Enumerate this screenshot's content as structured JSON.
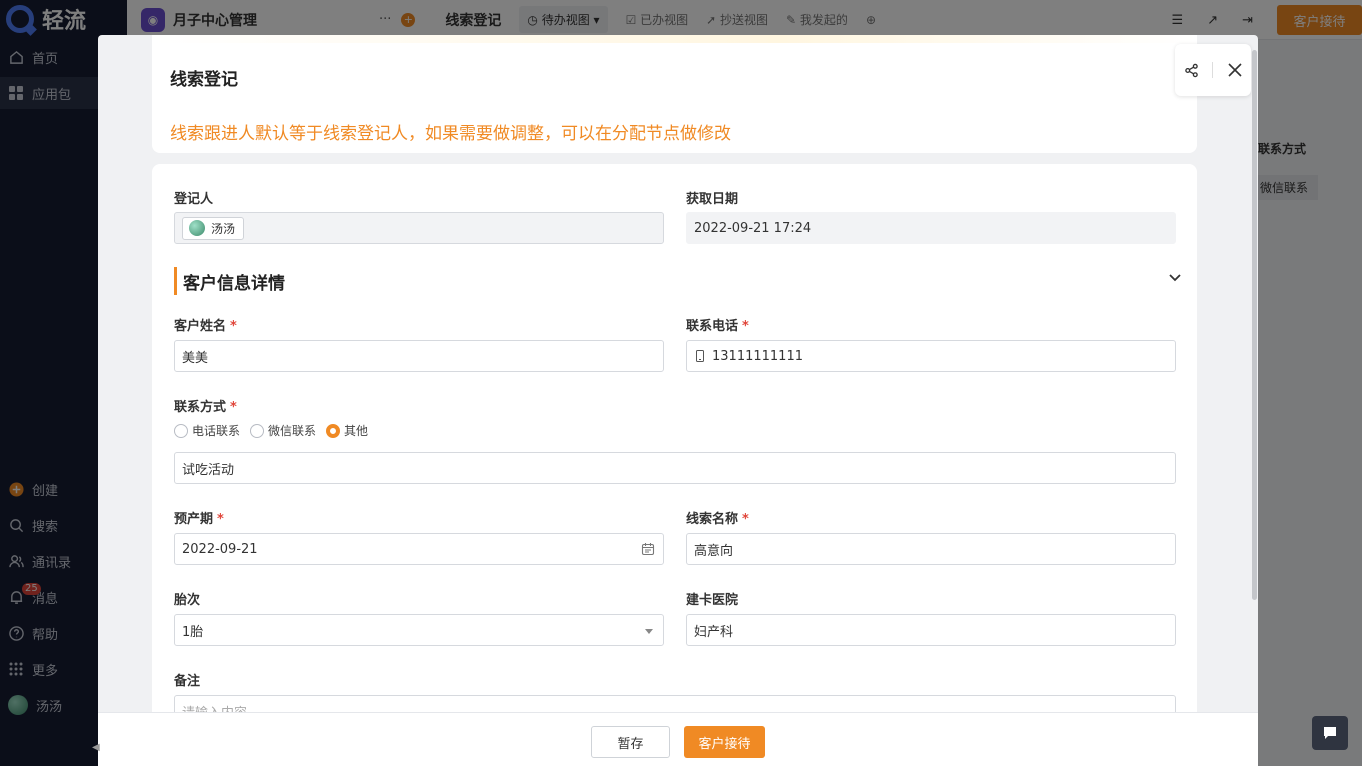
{
  "app": {
    "logo_text": "轻流",
    "title": "月子中心管理",
    "more": "···"
  },
  "sidebar": {
    "items": [
      {
        "label": "首页",
        "icon": "home-icon"
      },
      {
        "label": "应用包",
        "icon": "grid-icon",
        "active": true
      }
    ],
    "bottom_items": [
      {
        "label": "创建",
        "icon": "plus-circle-icon"
      },
      {
        "label": "搜索",
        "icon": "search-icon"
      },
      {
        "label": "通讯录",
        "icon": "contacts-icon"
      },
      {
        "label": "消息",
        "icon": "bell-icon",
        "badge": "25"
      },
      {
        "label": "帮助",
        "icon": "help-icon"
      },
      {
        "label": "更多",
        "icon": "more-grid-icon"
      },
      {
        "label": "汤汤",
        "icon": "avatar"
      }
    ]
  },
  "topbar": {
    "form_name": "线索登记",
    "views": [
      {
        "label": "待办视图",
        "active": true
      },
      {
        "label": "已办视图"
      },
      {
        "label": "抄送视图"
      },
      {
        "label": "我发起的"
      }
    ],
    "primary_button": "客户接待"
  },
  "background_table": {
    "header": "联系方式",
    "cell": "微信联系"
  },
  "modal": {
    "title": "线索登记",
    "description": "线索跟进人默认等于线索登记人，如果需要做调整，可以在分配节点做修改",
    "registrant": {
      "label": "登记人",
      "value": "汤汤"
    },
    "acquire_date": {
      "label": "获取日期",
      "value": "2022-09-21 17:24"
    },
    "section_title": "客户信息详情",
    "customer_name": {
      "label": "客户姓名",
      "required": "*",
      "value": "美美"
    },
    "phone": {
      "label": "联系电话",
      "required": "*",
      "value": "13111111111"
    },
    "contact_method": {
      "label": "联系方式",
      "required": "*",
      "options": [
        "电话联系",
        "微信联系",
        "其他"
      ],
      "selected": "其他",
      "other_value": "试吃活动"
    },
    "due_date": {
      "label": "预产期",
      "required": "*",
      "value": "2022-09-21"
    },
    "lead_name": {
      "label": "线索名称",
      "required": "*",
      "value": "高意向"
    },
    "parity": {
      "label": "胎次",
      "value": "1胎"
    },
    "hospital": {
      "label": "建卡医院",
      "value": "妇产科"
    },
    "remark": {
      "label": "备注",
      "placeholder": "请输入内容"
    },
    "buttons": {
      "save": "暂存",
      "submit": "客户接待"
    }
  },
  "colors": {
    "accent": "#f08a24",
    "sidebar_bg": "#161d33",
    "required": "#e0453a"
  }
}
